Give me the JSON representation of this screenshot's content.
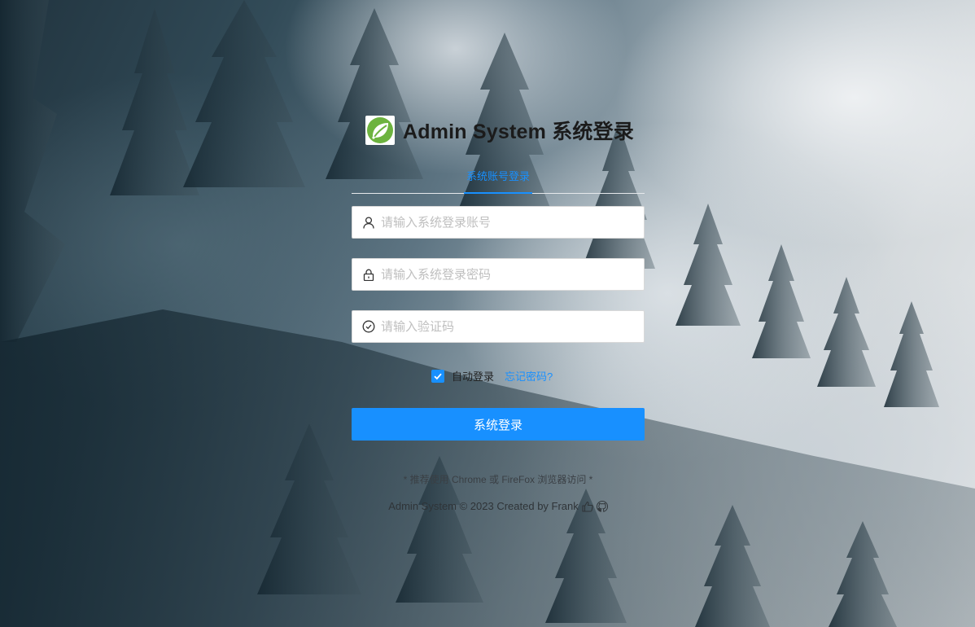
{
  "app": {
    "title": "Admin System 系统登录"
  },
  "tabs": [
    {
      "label": "系统账号登录",
      "active": true
    }
  ],
  "form": {
    "username_placeholder": "请输入系统登录账号",
    "password_placeholder": "请输入系统登录密码",
    "captcha_placeholder": "请输入验证码",
    "remember_label": "自动登录",
    "remember_checked": true,
    "forgot_label": "忘记密码?",
    "submit_label": "系统登录"
  },
  "tip": "* 推荐使用 Chrome 或 FireFox 浏览器访问 *",
  "footer": {
    "text": "Admin System © 2023 Created by Frank"
  },
  "icons": {
    "logo": "spring-leaf-logo",
    "username": "user-icon",
    "password": "lock-icon",
    "captcha": "check-circle-icon",
    "like": "like-icon",
    "github": "github-icon"
  },
  "colors": {
    "primary": "#1890ff",
    "logo_green": "#6db33f"
  }
}
